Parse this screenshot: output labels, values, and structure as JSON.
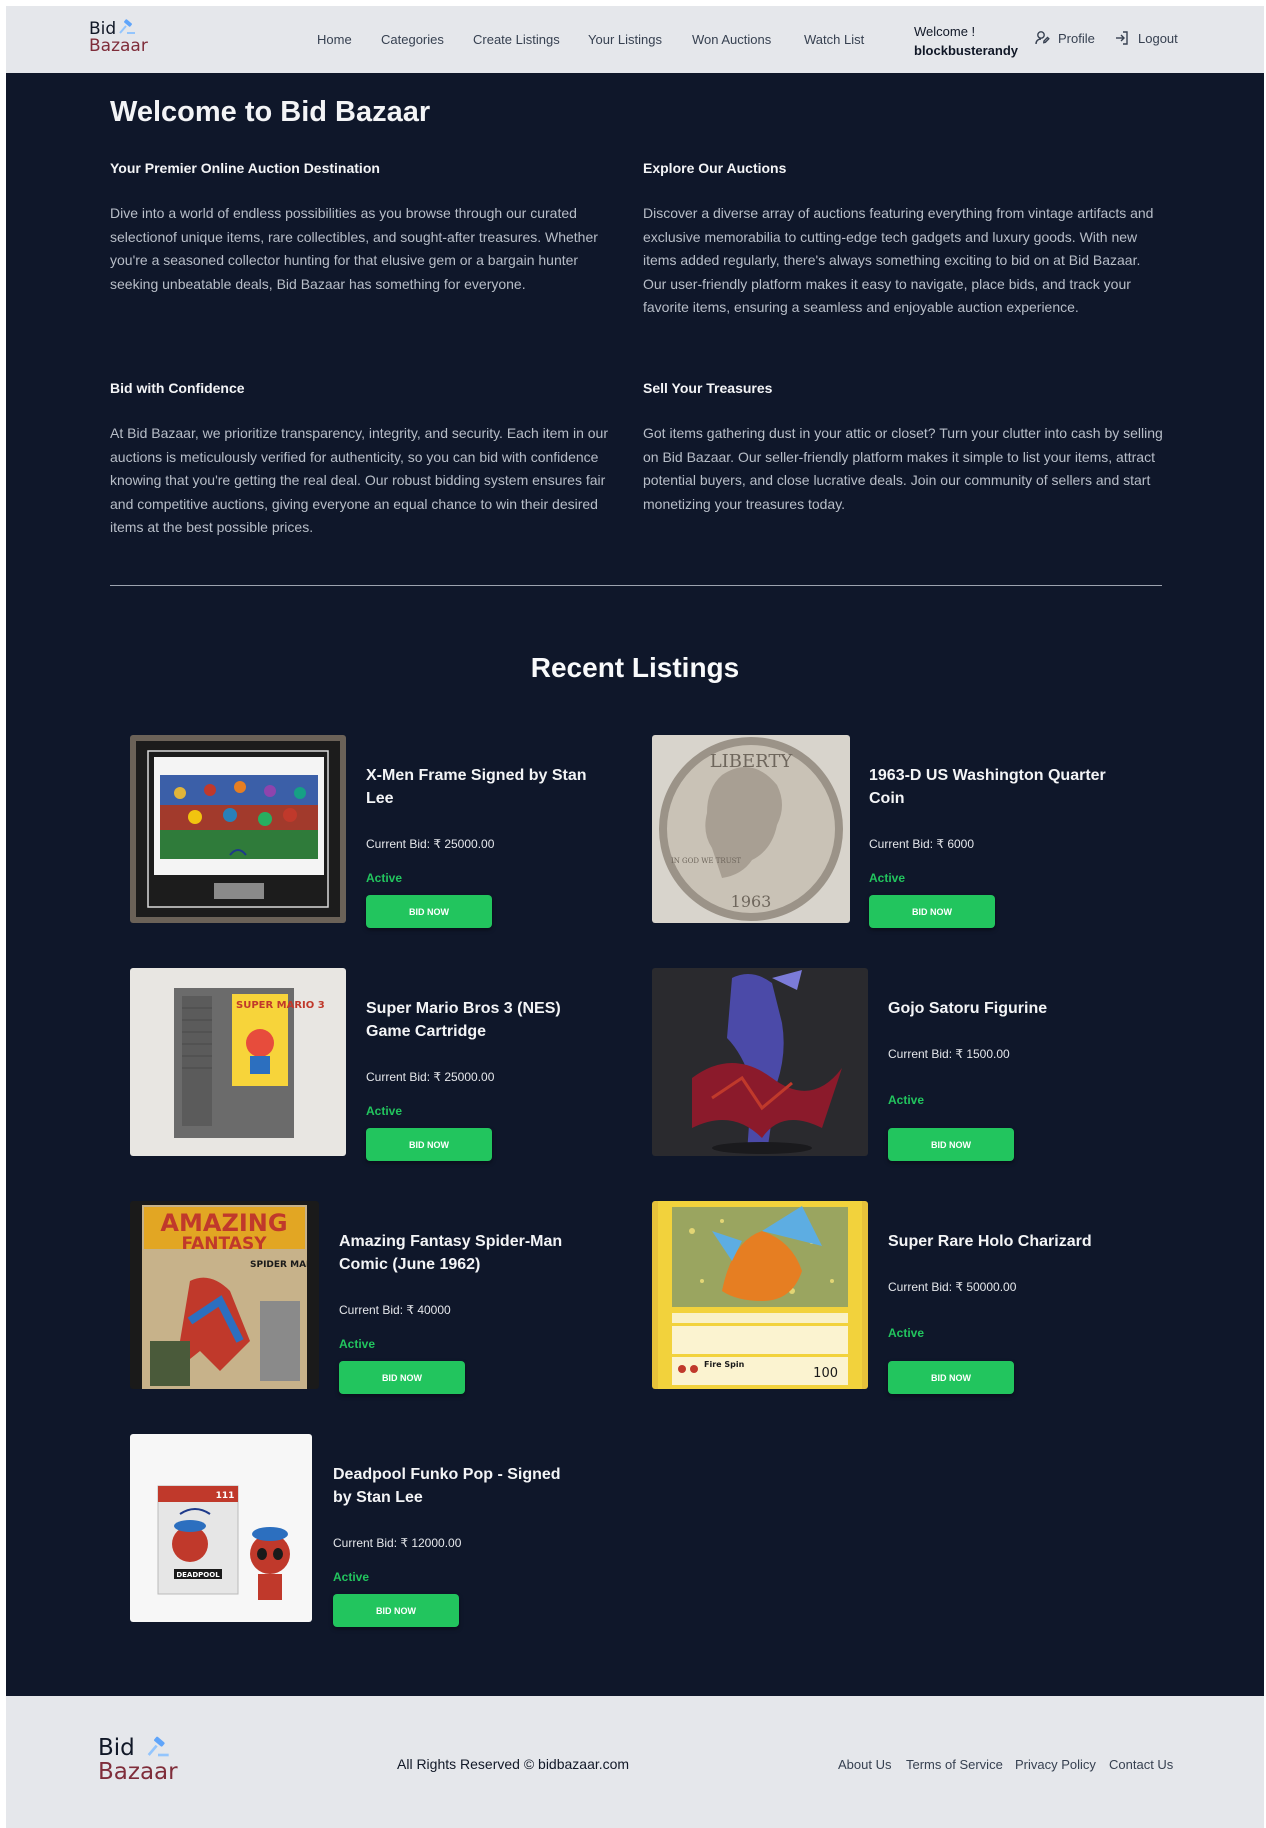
{
  "header": {
    "logo": {
      "line1": "Bid",
      "line2": "Bazaar"
    },
    "nav": [
      "Home",
      "Categories",
      "Create Listings",
      "Your Listings",
      "Won Auctions",
      "Watch List"
    ],
    "welcome_label": "Welcome !",
    "username": "blockbusterandy",
    "profile_label": "Profile",
    "logout_label": "Logout"
  },
  "intro": {
    "title": "Welcome to Bid Bazaar",
    "sections": [
      {
        "heading": "Your Premier Online Auction Destination",
        "body": "Dive into a world of endless possibilities as you browse through our curated selectionof unique items, rare collectibles, and sought-after treasures. Whether you're a seasoned collector hunting for that elusive gem or a bargain hunter seeking unbeatable deals, Bid Bazaar has something for everyone."
      },
      {
        "heading": "Explore Our Auctions",
        "body": "Discover a diverse array of auctions featuring everything from vintage artifacts and exclusive memorabilia to cutting-edge tech gadgets and luxury goods. With new items added regularly, there's always something exciting to bid on at Bid Bazaar. Our user-friendly platform makes it easy to navigate, place bids, and track your favorite items, ensuring a seamless and enjoyable auction experience."
      },
      {
        "heading": "Bid with Confidence",
        "body": "At Bid Bazaar, we prioritize transparency, integrity, and security. Each item in our auctions is meticulously verified for authenticity, so you can bid with confidence knowing that you're getting the real deal. Our robust bidding system ensures fair and competitive auctions, giving everyone an equal chance to win their desired items at the best possible prices."
      },
      {
        "heading": "Sell Your Treasures",
        "body": "Got items gathering dust in your attic or closet? Turn your clutter into cash by selling on Bid Bazaar. Our seller-friendly platform makes it simple to list your items, attract potential buyers, and close lucrative deals. Join our community of sellers and start monetizing your treasures today."
      }
    ]
  },
  "listings": {
    "title": "Recent Listings",
    "bid_button_label": "BID NOW",
    "items": [
      {
        "title": "X-Men Frame Signed by Stan Lee",
        "bid": "Current Bid: ₹ 25000.00",
        "status": "Active",
        "image": "xmen-frame-image"
      },
      {
        "title": "1963-D US Washington Quarter Coin",
        "bid": "Current Bid: ₹ 6000",
        "status": "Active",
        "image": "quarter-coin-image"
      },
      {
        "title": "Super Mario Bros 3 (NES) Game Cartridge",
        "bid": "Current Bid: ₹ 25000.00",
        "status": "Active",
        "image": "mario-cartridge-image"
      },
      {
        "title": "Gojo Satoru Figurine",
        "bid": "Current Bid: ₹ 1500.00",
        "status": "Active",
        "image": "gojo-figurine-image"
      },
      {
        "title": "Amazing Fantasy Spider-Man Comic (June 1962)",
        "bid": "Current Bid: ₹ 40000",
        "status": "Active",
        "image": "spiderman-comic-image"
      },
      {
        "title": "Super Rare Holo Charizard",
        "bid": "Current Bid: ₹ 50000.00",
        "status": "Active",
        "image": "charizard-card-image"
      },
      {
        "title": "Deadpool Funko Pop - Signed by Stan Lee",
        "bid": "Current Bid: ₹ 12000.00",
        "status": "Active",
        "image": "deadpool-funko-image"
      }
    ],
    "image_text": {
      "coin_top": "LIBERTY",
      "coin_motto": "IN GOD WE TRUST",
      "coin_year": "1963",
      "cart_title": "SUPER MARIO 3",
      "comic_title1": "AMAZING",
      "comic_title2": "FANTASY",
      "comic_tag": "SPIDER MAN",
      "charizard_attack": "Fire Spin",
      "charizard_damage": "100",
      "funko_name": "DEADPOOL",
      "funko_number": "111"
    }
  },
  "footer": {
    "logo": {
      "line1": "Bid",
      "line2": "Bazaar"
    },
    "copyright": "All Rights Reserved © bidbazaar.com",
    "links": [
      "About Us",
      "Terms of Service",
      "Privacy Policy",
      "Contact Us"
    ]
  },
  "colors": {
    "page_bg": "#0f172a",
    "header_bg": "#e5e7eb",
    "accent_green": "#22c55e",
    "logo_maroon": "#7f2d3a"
  }
}
